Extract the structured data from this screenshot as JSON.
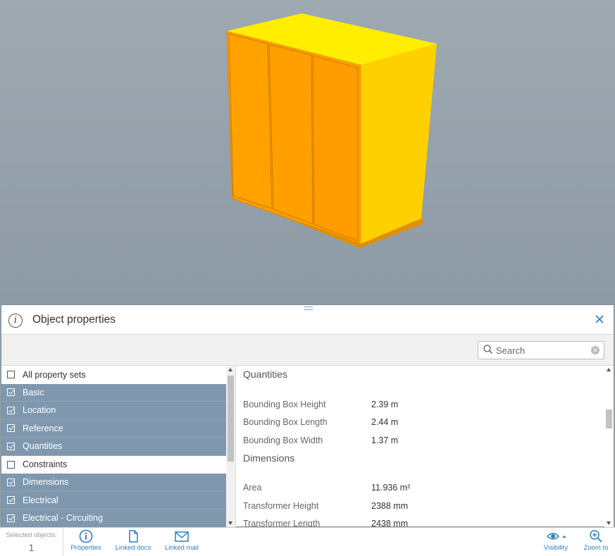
{
  "panel": {
    "title": "Object properties",
    "close_icon": "close-icon"
  },
  "search": {
    "placeholder": "Search"
  },
  "property_sets": [
    {
      "label": "All property sets",
      "checked": false
    },
    {
      "label": "Basic",
      "checked": true
    },
    {
      "label": "Location",
      "checked": true
    },
    {
      "label": "Reference",
      "checked": true
    },
    {
      "label": "Quantities",
      "checked": true
    },
    {
      "label": "Constraints",
      "checked": false
    },
    {
      "label": "Dimensions",
      "checked": true
    },
    {
      "label": "Electrical",
      "checked": true
    },
    {
      "label": "Electrical - Circuiting",
      "checked": true
    }
  ],
  "sections": [
    {
      "title": "Quantities",
      "rows": [
        {
          "key": "Bounding Box Height",
          "value": "2.39 m"
        },
        {
          "key": "Bounding Box Length",
          "value": "2.44 m"
        },
        {
          "key": "Bounding Box Width",
          "value": "1.37 m"
        }
      ]
    },
    {
      "title": "Dimensions",
      "rows": [
        {
          "key": "Area",
          "value": "11.936 m²"
        },
        {
          "key": "Transformer Height",
          "value": "2388 mm"
        },
        {
          "key": "Transformer Length",
          "value": "2438 mm"
        }
      ]
    }
  ],
  "toolbar": {
    "selected_label": "Selected objects:",
    "selected_count": "1",
    "properties": "Properties",
    "linked_docs": "Linked docs",
    "linked_mail": "Linked mail",
    "visibility": "Visibility",
    "zoom_to": "Zoom to"
  },
  "colors": {
    "accent": "#2c7fc1",
    "checked_row": "#7f98ae",
    "model_front": "#ff9f00",
    "model_side": "#ffd000",
    "model_top": "#ffee00"
  }
}
